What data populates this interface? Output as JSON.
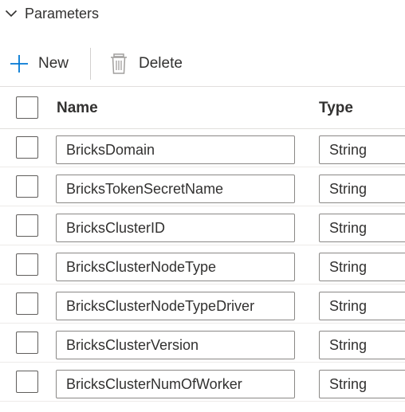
{
  "section": {
    "title": "Parameters",
    "icon": "chevron-down-icon"
  },
  "toolbar": {
    "new_label": "New",
    "new_icon": "plus-icon",
    "delete_label": "Delete",
    "delete_icon": "trash-icon"
  },
  "table": {
    "columns": [
      "Name",
      "Type"
    ],
    "rows": [
      {
        "name": "BricksDomain",
        "type": "String"
      },
      {
        "name": "BricksTokenSecretName",
        "type": "String"
      },
      {
        "name": "BricksClusterID",
        "type": "String"
      },
      {
        "name": "BricksClusterNodeType",
        "type": "String"
      },
      {
        "name": "BricksClusterNodeTypeDriver",
        "type": "String"
      },
      {
        "name": "BricksClusterVersion",
        "type": "String"
      },
      {
        "name": "BricksClusterNumOfWorker",
        "type": "String"
      }
    ]
  },
  "colors": {
    "accent": "#0078d4",
    "border": "#8a8886",
    "text": "#323130",
    "disabled_icon": "#a19f9d"
  }
}
